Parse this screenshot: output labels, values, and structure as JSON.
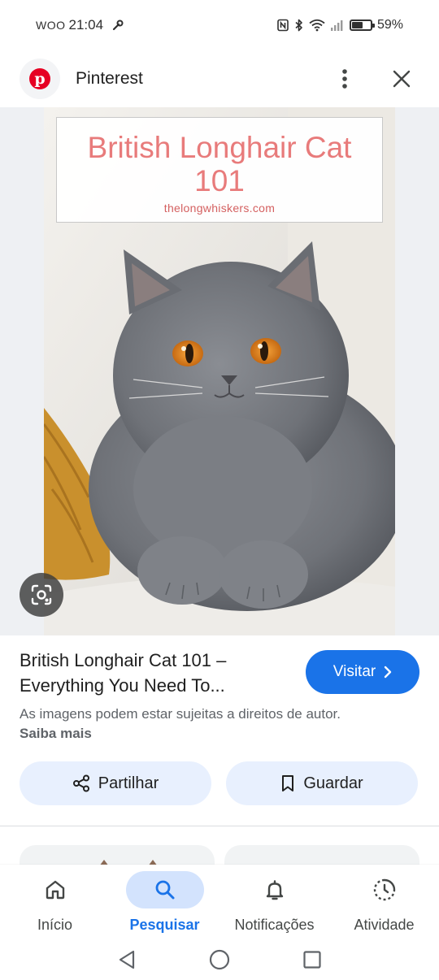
{
  "status_bar": {
    "carrier": "WOO",
    "time": "21:04",
    "battery": "59%",
    "battery_level": 0.59
  },
  "header": {
    "app_title": "Pinterest",
    "logo_glyph": "p"
  },
  "image": {
    "overlay_title_line1": "British Longhair Cat",
    "overlay_title_line2": "101",
    "overlay_site": "thelongwhiskers.com"
  },
  "info": {
    "title": "British Longhair Cat 101 – Everything You Need To...",
    "visit_label": "Visitar",
    "copyright_text": "As imagens podem estar sujeitas a direitos de autor.",
    "learn_more": "Saiba mais"
  },
  "actions": {
    "share_label": "Partilhar",
    "save_label": "Guardar"
  },
  "bottom_nav": {
    "items": [
      {
        "label": "Início",
        "icon": "home-icon"
      },
      {
        "label": "Pesquisar",
        "icon": "search-icon"
      },
      {
        "label": "Notificações",
        "icon": "bell-icon"
      },
      {
        "label": "Atividade",
        "icon": "activity-icon"
      }
    ],
    "active_index": 1
  },
  "colors": {
    "accent": "#1a73e8",
    "accent_light": "#d3e3fd",
    "chip_bg": "#e8f0fe",
    "pinterest_red": "#e60023",
    "overlay_title": "#e87b7b"
  }
}
